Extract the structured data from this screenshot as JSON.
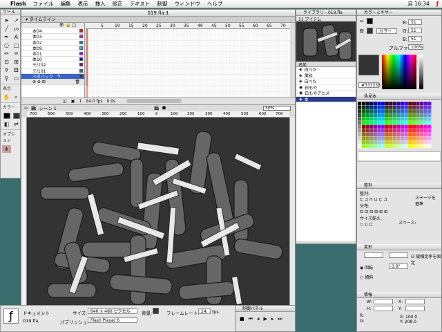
{
  "menubar": {
    "app": "Flash",
    "items": [
      "ファイル",
      "編集",
      "表示",
      "挿入",
      "修正",
      "テキスト",
      "制御",
      "ウィンドウ",
      "ヘルプ"
    ],
    "clock": "月 16:34"
  },
  "tools": {
    "title": "ツール",
    "view_label": "表示",
    "colors_label": "カラー",
    "options_label": "オプション"
  },
  "document": {
    "title": "019.fla:1",
    "timeline_label": "タイムライン",
    "scene_label": "シーン 1",
    "zoom": "50%",
    "frame_numbers": [
      "5",
      "10",
      "15",
      "20",
      "25",
      "30",
      "35",
      "40",
      "45",
      "50",
      "55",
      "60",
      "65",
      "70"
    ],
    "layers": [
      "本04",
      "本03",
      "本02",
      "本09",
      "本01",
      "本10",
      "テ/102",
      "テ/101",
      "ベタバック"
    ],
    "status": {
      "frame": "1",
      "fps": "24.0 fps",
      "time": "0.0s"
    },
    "ruler": [
      "700",
      "600",
      "500",
      "400",
      "300",
      "200",
      "100",
      "0",
      "100",
      "200",
      "300",
      "400",
      "500",
      "600",
      "700"
    ]
  },
  "properties": {
    "doc_label": "ドキュメント",
    "filename": "019.fla",
    "size_label": "サイズ:",
    "size_value": "640 × 480 ピクセル",
    "bg_label": "背景:",
    "framerate_label": "フレームレート:",
    "framerate_value": "24",
    "fps_unit": "fps",
    "publish_label": "パブリッシュ:",
    "publish_value": "Flash Player 6"
  },
  "controller": {
    "title": "制御パネル"
  },
  "library": {
    "title": "ライブラリ - 019.fla",
    "count": "11 アイテム",
    "name_header": "名前",
    "items": [
      "白べた",
      "黒枠",
      "白べた",
      "白もや",
      "白もやアニメ",
      "本"
    ]
  },
  "color_mixer": {
    "title": "カラーミキサー",
    "mode": "カラー",
    "r_label": "R:",
    "r": "51",
    "g_label": "G:",
    "g": "51",
    "b_label": "B:",
    "b": "51",
    "alpha_label": "アルファ:",
    "alpha": "100%",
    "hex": "#333333"
  },
  "swatches": {
    "title": "色見本"
  },
  "align": {
    "title": "整列",
    "align_label": "整列:",
    "distribute_label": "分布:",
    "match_label": "サイズ揃え:",
    "space_label": "スペース:",
    "stage_label": "ステージを基準"
  },
  "transform": {
    "title": "変形",
    "constrain_label": "縦横比率を固定",
    "rotate_label": "回転",
    "skew_label": "傾斜",
    "rotate_value": "0.0°"
  },
  "info": {
    "title": "情報",
    "w_label": "W:",
    "h_label": "H:",
    "x_label": "X:",
    "y_label": "Y:",
    "r_label": "R:",
    "g_label": "G:",
    "b_label": "B:",
    "a_label": "A:",
    "x_coord": "X: 100.0",
    "y_coord": "Y: 208.0"
  },
  "colors": {
    "accent": "#3b63c6",
    "stage_bg": "#333333"
  }
}
